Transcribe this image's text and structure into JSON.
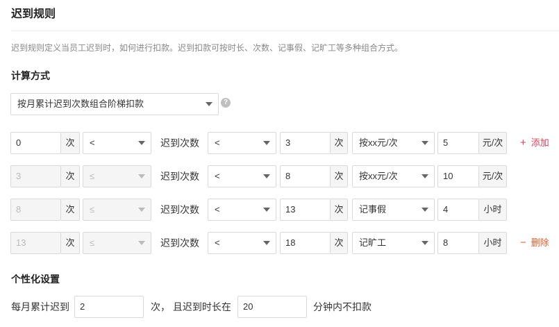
{
  "header": {
    "title": "迟到规则",
    "description": "迟到规则定义当员工迟到时，如何进行扣款。迟到扣款可按时长、次数、记事假、记旷工等多种组合方式。"
  },
  "calc": {
    "title": "计算方式",
    "method_value": "按月累计迟到次数组合阶梯扣款",
    "help_icon": "?"
  },
  "rules": [
    {
      "from": "0",
      "from_unit": "次",
      "op1": "<",
      "middle_label": "迟到次数",
      "op2": "<",
      "to": "3",
      "to_unit": "次",
      "type": "按xx元/次",
      "amount": "5",
      "amount_unit": "元/次",
      "action_symbol": "+",
      "action_label": "添加"
    },
    {
      "from": "3",
      "from_unit": "次",
      "op1": "≤",
      "middle_label": "迟到次数",
      "op2": "<",
      "to": "8",
      "to_unit": "次",
      "type": "按xx元/次",
      "amount": "10",
      "amount_unit": "元/次"
    },
    {
      "from": "8",
      "from_unit": "次",
      "op1": "≤",
      "middle_label": "迟到次数",
      "op2": "<",
      "to": "13",
      "to_unit": "次",
      "type": "记事假",
      "amount": "4",
      "amount_unit": "小时"
    },
    {
      "from": "13",
      "from_unit": "次",
      "op1": "≤",
      "middle_label": "迟到次数",
      "op2": "<",
      "to": "18",
      "to_unit": "次",
      "type": "记旷工",
      "amount": "8",
      "amount_unit": "小时",
      "action_symbol": "−",
      "action_label": "删除"
    }
  ],
  "personal": {
    "title": "个性化设置",
    "prefix": "每月累计迟到",
    "count_value": "2",
    "mid": "次， 且迟到时长在",
    "minutes_value": "20",
    "suffix": "分钟内不扣款"
  }
}
